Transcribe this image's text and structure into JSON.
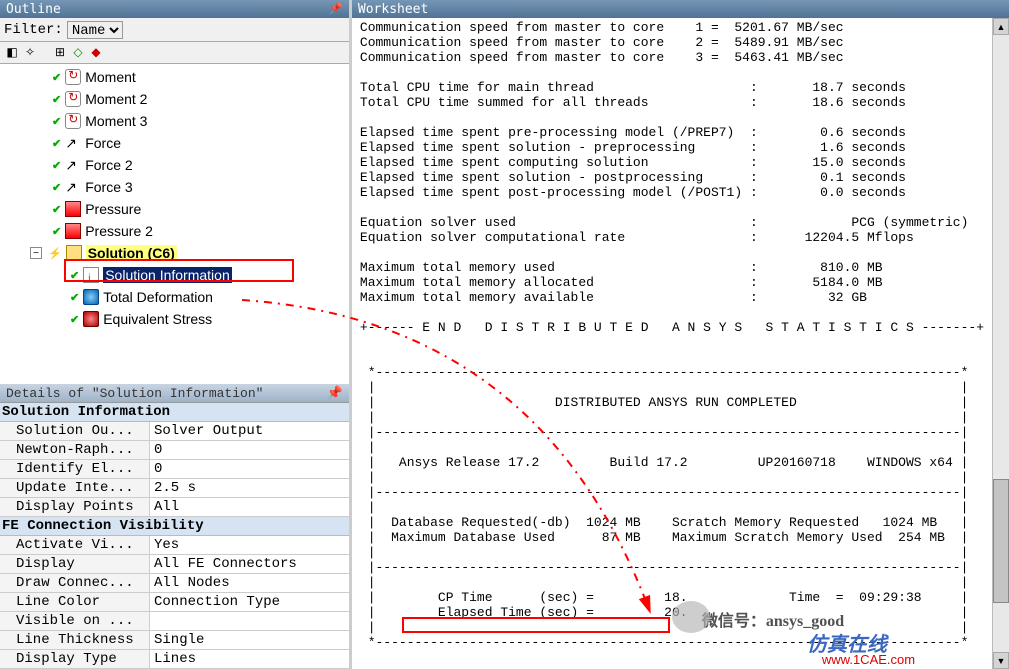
{
  "outline": {
    "title": "Outline",
    "filter_label": "Filter:",
    "filter_value": "Name",
    "tree": [
      {
        "icon": "moment",
        "label": "Moment",
        "level": 1
      },
      {
        "icon": "moment",
        "label": "Moment 2",
        "level": 1
      },
      {
        "icon": "moment",
        "label": "Moment 3",
        "level": 1
      },
      {
        "icon": "force",
        "label": "Force",
        "level": 1
      },
      {
        "icon": "force",
        "label": "Force 2",
        "level": 1
      },
      {
        "icon": "force",
        "label": "Force 3",
        "level": 1
      },
      {
        "icon": "press",
        "label": "Pressure",
        "level": 1
      },
      {
        "icon": "press",
        "label": "Pressure 2",
        "level": 1
      },
      {
        "icon": "sol",
        "label": "Solution (C6)",
        "level": 0,
        "expand": "-",
        "sel": "solution"
      },
      {
        "icon": "info",
        "label": "Solution Information",
        "level": 2,
        "sel": "info"
      },
      {
        "icon": "def",
        "label": "Total Deformation",
        "level": 2
      },
      {
        "icon": "eq",
        "label": "Equivalent Stress",
        "level": 2
      }
    ]
  },
  "details": {
    "title": "Details of \"Solution Information\"",
    "section1": "Solution Information",
    "rows1": [
      {
        "k": "Solution Ou...",
        "v": "Solver Output"
      },
      {
        "k": "Newton-Raph...",
        "v": "0"
      },
      {
        "k": "Identify El...",
        "v": "0"
      },
      {
        "k": "Update Inte...",
        "v": "2.5 s"
      },
      {
        "k": "Display Points",
        "v": "All"
      }
    ],
    "section2": "FE Connection Visibility",
    "rows2": [
      {
        "k": "Activate Vi...",
        "v": "Yes"
      },
      {
        "k": "Display",
        "v": "All FE Connectors"
      },
      {
        "k": "Draw Connec...",
        "v": "All Nodes"
      },
      {
        "k": "Line Color",
        "v": "Connection Type"
      },
      {
        "k": "Visible on ...",
        "v": ""
      },
      {
        "k": "Line Thickness",
        "v": "Single"
      },
      {
        "k": "Display Type",
        "v": "Lines"
      }
    ]
  },
  "worksheet": {
    "title": "Worksheet",
    "lines": [
      "Communication speed from master to core    1 =  5201.67 MB/sec",
      "Communication speed from master to core    2 =  5489.91 MB/sec",
      "Communication speed from master to core    3 =  5463.41 MB/sec",
      "",
      "Total CPU time for main thread                    :       18.7 seconds",
      "Total CPU time summed for all threads             :       18.6 seconds",
      "",
      "Elapsed time spent pre-processing model (/PREP7)  :        0.6 seconds",
      "Elapsed time spent solution - preprocessing       :        1.6 seconds",
      "Elapsed time spent computing solution             :       15.0 seconds",
      "Elapsed time spent solution - postprocessing      :        0.1 seconds",
      "Elapsed time spent post-processing model (/POST1) :        0.0 seconds",
      "",
      "Equation solver used                              :            PCG (symmetric)",
      "Equation solver computational rate                :      12204.5 Mflops",
      "",
      "Maximum total memory used                         :        810.0 MB",
      "Maximum total memory allocated                    :       5184.0 MB",
      "Maximum total memory available                    :         32 GB",
      "",
      "+------ E N D   D I S T R I B U T E D   A N S Y S   S T A T I S T I C S -------+",
      "",
      "",
      " *---------------------------------------------------------------------------*",
      " |                                                                           |",
      " |                       DISTRIBUTED ANSYS RUN COMPLETED                     |",
      " |                                                                           |",
      " |---------------------------------------------------------------------------|",
      " |                                                                           |",
      " |   Ansys Release 17.2         Build 17.2         UP20160718    WINDOWS x64 |",
      " |                                                                           |",
      " |---------------------------------------------------------------------------|",
      " |                                                                           |",
      " |  Database Requested(-db)  1024 MB    Scratch Memory Requested   1024 MB   |",
      " |  Maximum Database Used      87 MB    Maximum Scratch Memory Used  254 MB  |",
      " |                                                                           |",
      " |---------------------------------------------------------------------------|",
      " |                                                                           |",
      " |        CP Time      (sec) =         18.             Time  =  09:29:38     |",
      " |        Elapsed Time (sec) =         20.                                   |",
      " |                                                                           |",
      " *---------------------------------------------------------------------------*"
    ]
  },
  "overlay": {
    "wechat": "微信号：ansys_good",
    "brand": "仿真在线",
    "url": "www.1CAE.com"
  }
}
